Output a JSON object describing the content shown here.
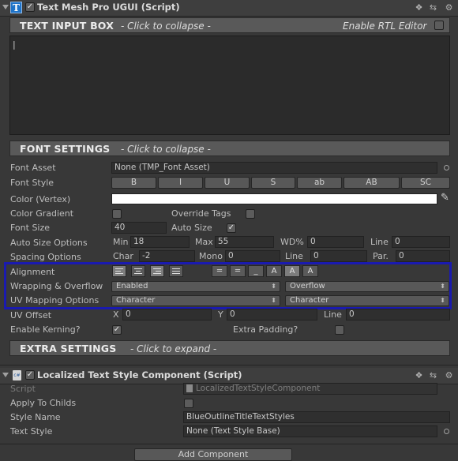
{
  "component1": {
    "title": "Text Mesh Pro UGUI (Script)",
    "icon": "T",
    "enabled": true
  },
  "text_input": {
    "title": "TEXT INPUT BOX",
    "subtitle": "- Click to collapse -",
    "rtl_label": "Enable RTL Editor",
    "text": "|"
  },
  "font_settings": {
    "title": "FONT SETTINGS",
    "subtitle": "- Click to collapse -",
    "font_asset_label": "Font Asset",
    "font_asset_value": "None (TMP_Font Asset)",
    "font_style_label": "Font Style",
    "style_buttons": [
      "B",
      "I",
      "U",
      "S",
      "ab",
      "AB",
      "SC"
    ],
    "color_label": "Color (Vertex)",
    "color_value": "#ffffff",
    "gradient_label": "Color Gradient",
    "override_tags_label": "Override Tags",
    "font_size_label": "Font Size",
    "font_size_value": "40",
    "auto_size_label": "Auto Size",
    "auto_size_checked": true,
    "auto_size_options_label": "Auto Size Options",
    "min_label": "Min",
    "min_value": "18",
    "max_label": "Max",
    "max_value": "55",
    "wd_label": "WD%",
    "wd_value": "0",
    "line_label": "Line",
    "line_value": "0",
    "spacing_label": "Spacing Options",
    "char_label": "Char",
    "char_value": "-2",
    "mono_label": "Mono",
    "mono_value": "0",
    "sp_line_label": "Line",
    "sp_line_value": "0",
    "par_label": "Par.",
    "par_value": "0",
    "alignment_label": "Alignment",
    "wrapping_label": "Wrapping & Overflow",
    "wrapping_value": "Enabled",
    "overflow_value": "Overflow",
    "uv_mapping_label": "UV Mapping Options",
    "uv_h_value": "Character",
    "uv_v_value": "Character",
    "uv_offset_label": "UV Offset",
    "uv_x_label": "X",
    "uv_x_value": "0",
    "uv_y_label": "Y",
    "uv_y_value": "0",
    "uv_line_label": "Line",
    "uv_line_value": "0",
    "kerning_label": "Enable Kerning?",
    "kerning_checked": true,
    "extra_padding_label": "Extra Padding?",
    "highlight_color": "#1a1ab0"
  },
  "extra_settings": {
    "title": "EXTRA SETTINGS",
    "subtitle": "- Click to expand -"
  },
  "component2": {
    "title": "Localized Text Style Component (Script)",
    "icon": "c#",
    "enabled": true,
    "script_label": "Script",
    "script_value": "LocalizedTextStyleComponent",
    "apply_label": "Apply To Childs",
    "style_name_label": "Style Name",
    "style_name_value": "BlueOutlineTitleTextStyles",
    "text_style_label": "Text Style",
    "text_style_value": "None (Text Style Base)"
  },
  "footer": {
    "add_component_label": "Add Component"
  }
}
